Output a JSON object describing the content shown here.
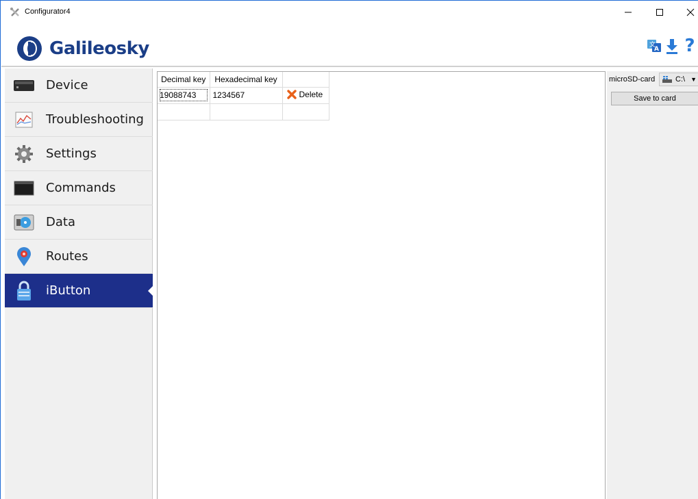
{
  "window": {
    "title": "Configurator4",
    "minimize_glyph": "—",
    "maximize_glyph": "☐",
    "close_glyph": "✕"
  },
  "header": {
    "logo_text": "Galileosky",
    "icons": [
      "translate-icon",
      "download-icon",
      "help-icon"
    ],
    "help_glyph": "?"
  },
  "sidebar": {
    "items": [
      {
        "label": "Device",
        "icon": "device-icon",
        "active": false
      },
      {
        "label": "Troubleshooting",
        "icon": "chart-icon",
        "active": false
      },
      {
        "label": "Settings",
        "icon": "gear-icon",
        "active": false
      },
      {
        "label": "Commands",
        "icon": "terminal-icon",
        "active": false
      },
      {
        "label": "Data",
        "icon": "data-disk-icon",
        "active": false
      },
      {
        "label": "Routes",
        "icon": "map-pin-icon",
        "active": false
      },
      {
        "label": "iButton",
        "icon": "lock-icon",
        "active": true
      }
    ]
  },
  "table": {
    "headers": [
      "Decimal key",
      "Hexadecimal key"
    ],
    "rows": [
      {
        "decimal": "19088743",
        "hex": "1234567",
        "action_label": "Delete"
      }
    ]
  },
  "right_panel": {
    "sd_label": "microSD-card",
    "drive_value": "C:\\",
    "save_label": "Save to card"
  },
  "colors": {
    "accent": "#1d2f8a",
    "logo_blue": "#1b3e87",
    "delete_orange": "#e8611a"
  }
}
